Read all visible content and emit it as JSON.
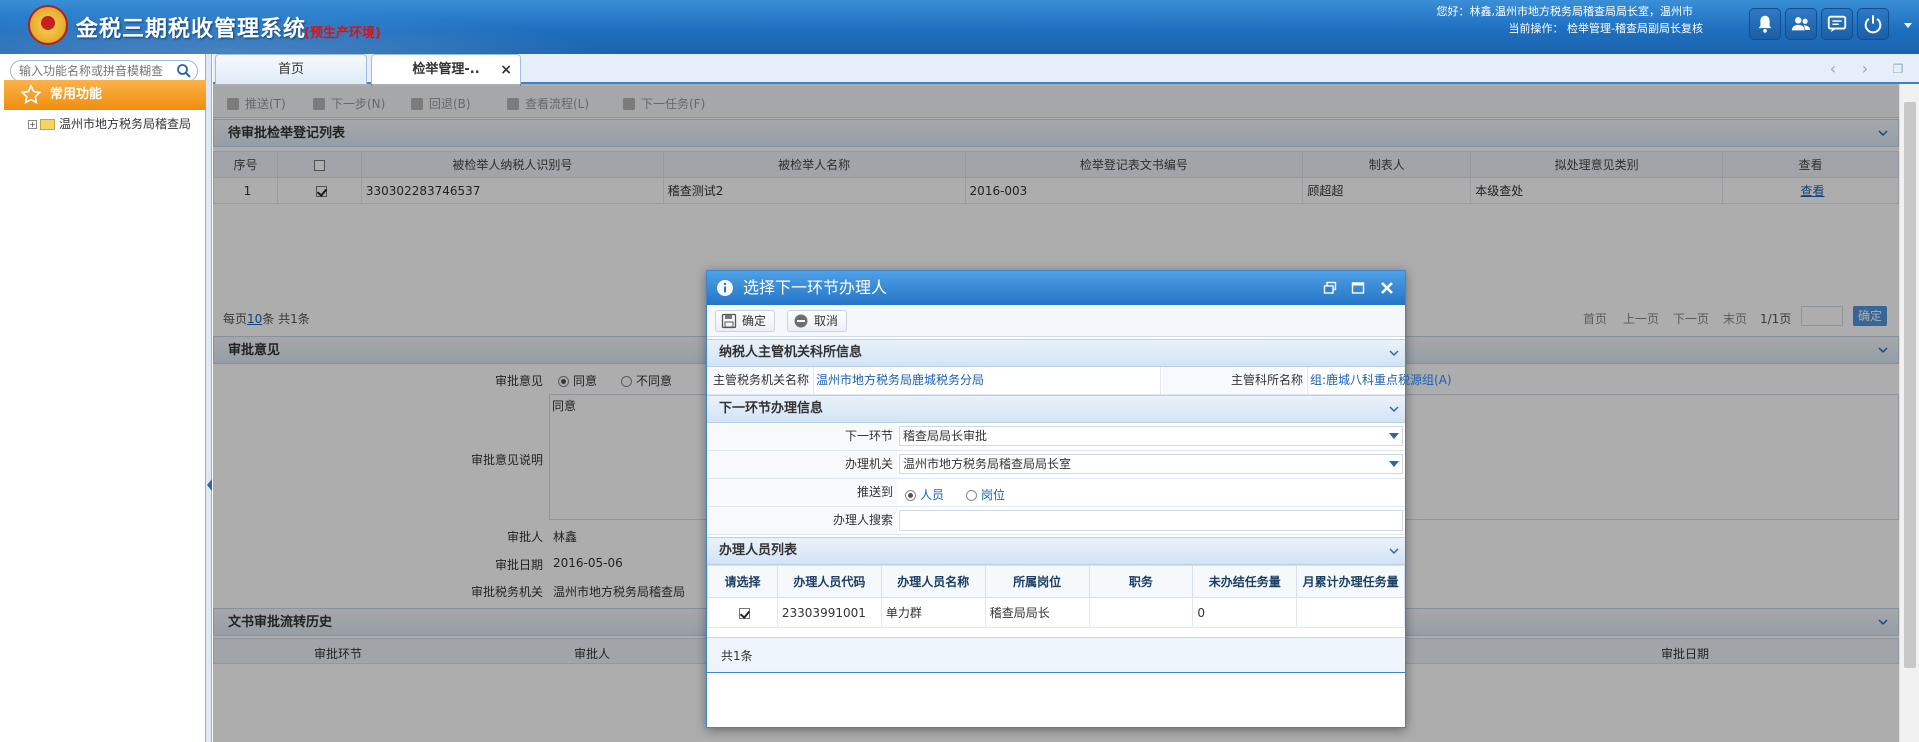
{
  "header": {
    "title": "金税三期税收管理系统",
    "env": "(预生产环境)",
    "greeting": "您好：林鑫,温州市地方税务局稽查局局长室，温州市",
    "current_op": "当前操作： 检举管理-稽查局副局长复核"
  },
  "sidebar": {
    "search_placeholder": "输入功能名称或拼音模糊查",
    "favorites": "常用功能",
    "tree_item": "温州市地方税务局稽查局"
  },
  "tabs": [
    {
      "label": "首页"
    },
    {
      "label": "检举管理-.."
    }
  ],
  "toolbar": {
    "push": "推送(T)",
    "next_step": "下一步(N)",
    "back": "回退(B)",
    "view_flow": "查看流程(L)",
    "next_task": "下一任务(F)"
  },
  "list_section": {
    "title": "待审批检举登记列表",
    "columns": [
      "序号",
      "",
      "被检举人纳税人识别号",
      "被检举人名称",
      "检举登记表文书编号",
      "制表人",
      "拟处理意见类别",
      "查看"
    ],
    "rows": [
      {
        "no": "1",
        "checked": true,
        "taxid": "330302283746537",
        "name": "稽查测试2",
        "docno": "2016-003",
        "maker": "顾超超",
        "opinion": "本级查处",
        "view": "查看"
      }
    ],
    "pager": {
      "per_page_prefix": "每页",
      "per_page": "10",
      "per_page_suffix": "条 共1条",
      "first": "首页",
      "prev": "上一页",
      "next": "下一页",
      "last": "末页",
      "page": "1/1页",
      "go": "确定"
    }
  },
  "approval": {
    "title": "审批意见",
    "opinion_label": "审批意见",
    "agree": "同意",
    "disagree": "不同意",
    "note_label": "审批意见说明",
    "note_value": "同意",
    "approver_label": "审批人",
    "approver_value": "林鑫",
    "date_label": "审批日期",
    "date_value": "2016-05-06",
    "org_label": "审批税务机关",
    "org_value": "温州市地方税务局稽查局"
  },
  "history": {
    "title": "文书审批流转历史",
    "col_node": "审批环节",
    "col_person": "审批人",
    "col_date": "审批日期"
  },
  "dialog": {
    "title": "选择下一环节办理人",
    "ok": "确定",
    "cancel": "取消",
    "sec_taxpayer": "纳税人主管机关科所信息",
    "org_label": "主管税务机关名称",
    "org_value": "温州市地方税务局鹿城税务分局",
    "dept_label": "主管科所名称",
    "dept_value": "组:鹿城八科重点税源组(A)",
    "sec_next": "下一环节办理信息",
    "next_node_label": "下一环节",
    "next_node_value": "稽查局局长审批",
    "office_label": "办理机关",
    "office_value": "温州市地方税务局稽查局局长室",
    "push_label": "推送到",
    "push_person": "人员",
    "push_post": "岗位",
    "search_label": "办理人搜索",
    "sec_list": "办理人员列表",
    "columns": [
      "请选择",
      "办理人员代码",
      "办理人员名称",
      "所属岗位",
      "职务",
      "未办结任务量",
      "月累计办理任务量"
    ],
    "rows": [
      {
        "checked": true,
        "code": "23303991001",
        "name": "单力群",
        "post": "稽查局局长",
        "duty": "",
        "pending": "0",
        "monthly": ""
      }
    ],
    "total": "共1条"
  }
}
